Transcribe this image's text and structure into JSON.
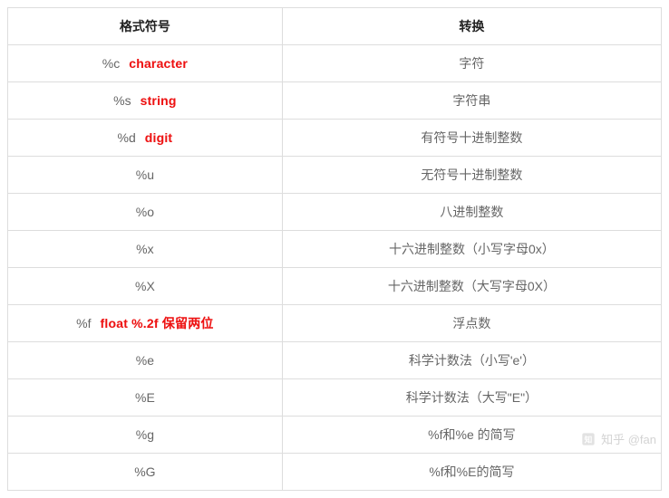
{
  "headers": {
    "col1": "格式符号",
    "col2": "转换"
  },
  "rows": [
    {
      "symbol": "%c",
      "annot": "character",
      "desc": "字符"
    },
    {
      "symbol": "%s",
      "annot": "string",
      "desc": "字符串"
    },
    {
      "symbol": "%d",
      "annot": "digit",
      "desc": "有符号十进制整数"
    },
    {
      "symbol": "%u",
      "annot": "",
      "desc": "无符号十进制整数"
    },
    {
      "symbol": "%o",
      "annot": "",
      "desc": "八进制整数"
    },
    {
      "symbol": "%x",
      "annot": "",
      "desc": "十六进制整数（小写字母0x）"
    },
    {
      "symbol": "%X",
      "annot": "",
      "desc": "十六进制整数（大写字母0X）"
    },
    {
      "symbol": "%f",
      "annot": "float  %.2f 保留两位",
      "desc": "浮点数"
    },
    {
      "symbol": "%e",
      "annot": "",
      "desc": "科学计数法（小写'e'）"
    },
    {
      "symbol": "%E",
      "annot": "",
      "desc": "科学计数法（大写\"E\"）"
    },
    {
      "symbol": "%g",
      "annot": "",
      "desc": "%f和%e 的简写"
    },
    {
      "symbol": "%G",
      "annot": "",
      "desc": "%f和%E的简写"
    }
  ],
  "watermark": "知乎 @fan"
}
